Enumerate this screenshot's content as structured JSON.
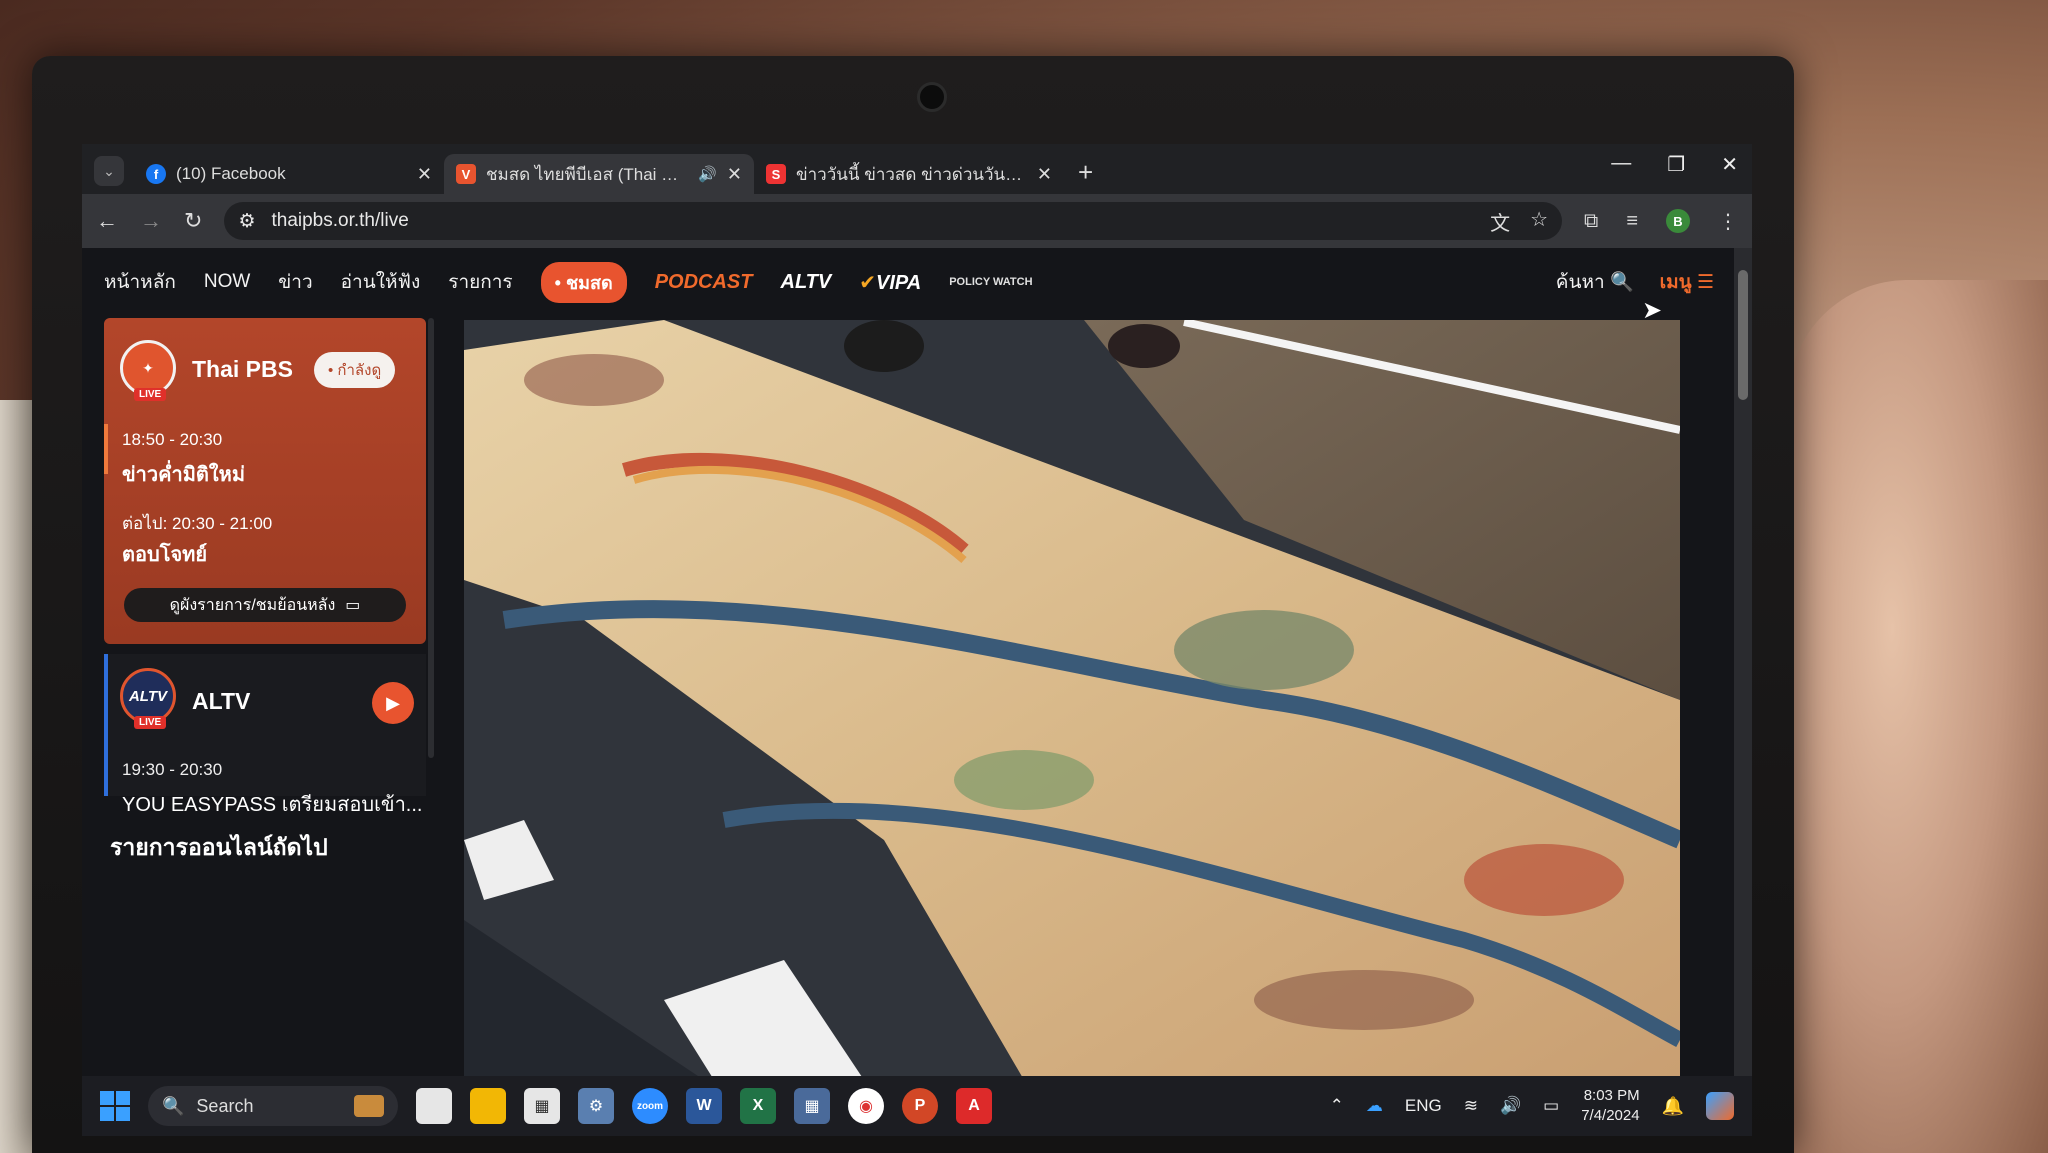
{
  "browser": {
    "tabs": [
      {
        "title": "(10) Facebook",
        "favicon": "facebook-icon",
        "active": false
      },
      {
        "title": "ชมสด ไทยพีบีเอส (Thai PBS Li",
        "favicon": "thaipbs-icon",
        "active": true,
        "audio": true
      },
      {
        "title": "ข่าววันนี้ ข่าวสด ข่าวด่วนวันนี้ ข่าวอ",
        "favicon": "news-icon",
        "active": false
      }
    ],
    "url": "thaipbs.or.th/live",
    "profile_initial": "B",
    "window_controls": [
      "minimize",
      "restore",
      "close"
    ]
  },
  "site_nav": {
    "items": [
      "หน้าหลัก",
      "NOW",
      "ข่าว",
      "อ่านให้ฟัง",
      "รายการ"
    ],
    "live_label": "ชมสด",
    "brands": [
      "PODCAST",
      "ALTV",
      "VIPA",
      "POLICY WATCH"
    ],
    "search_label": "ค้นหา",
    "menu_label": "เมนู"
  },
  "now_playing": {
    "channel": "Thai PBS",
    "logo_label": "LIVE",
    "status": "กำลังดู",
    "current_time": "18:50 - 20:30",
    "current_program": "ข่าวค่ำมิติใหม่",
    "next_time": "ต่อไป: 20:30 - 21:00",
    "next_program": "ตอบโจทย์",
    "archive_button": "ดูผังรายการ/ชมย้อนหลัง"
  },
  "other_channel": {
    "channel": "ALTV",
    "logo_label": "LIVE",
    "time": "19:30 - 20:30",
    "program": "YOU EASYPASS เตรียมสอบเข้า..."
  },
  "online_heading": "รายการออนไลน์ถัดไป",
  "taskbar": {
    "search_placeholder": "Search",
    "apps": [
      "file-explorer",
      "folder",
      "store",
      "settings",
      "zoom",
      "word",
      "excel",
      "calculator",
      "chrome",
      "powerpoint",
      "acrobat"
    ],
    "language": "ENG",
    "time": "8:03 PM",
    "date": "7/4/2024"
  },
  "colors": {
    "accent": "#e8542f",
    "card": "#b3462a",
    "alt_accent": "#2f6fdc"
  }
}
